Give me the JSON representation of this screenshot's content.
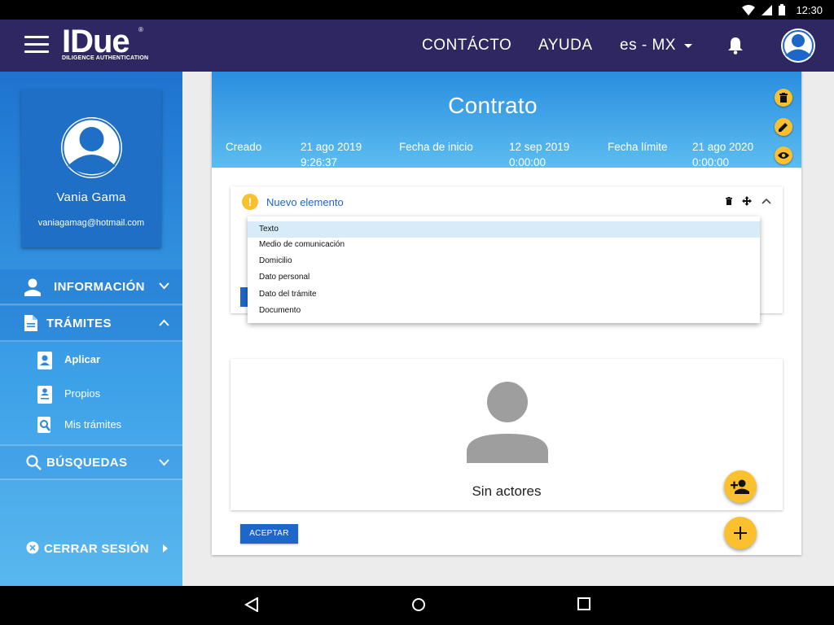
{
  "status_bar": {
    "time": "12:30"
  },
  "app_bar": {
    "logo_text": "IDue",
    "logo_subtitle": "DILIGENCE AUTHENTICATION",
    "logo_reg": "®",
    "nav_contact": "CONTÁCTO",
    "nav_help": "AYUDA",
    "language": "es - MX"
  },
  "sidebar": {
    "user_name": "Vania Gama",
    "user_email": "vaniagamag@hotmail.com",
    "menu": {
      "informacion": "INFORMACIÓN",
      "tramites": "TRÁMITES",
      "busquedas": "BÚSQUEDAS"
    },
    "sub_items": {
      "aplicar": "Aplicar",
      "propios": "Propios",
      "mis_tramites": "Mis trámites"
    },
    "logout": "CERRAR SESIÓN"
  },
  "contract": {
    "title": "Contrato",
    "created_label": "Creado",
    "created_date": "21 ago 2019",
    "created_time": "9:26:37",
    "start_label": "Fecha de inicio",
    "start_date": "12 sep 2019",
    "start_time": "0:00:00",
    "limit_label": "Fecha límite",
    "limit_date": "21 ago 2020",
    "limit_time": "0:00:00"
  },
  "element": {
    "title": "Nuevo elemento",
    "warning_glyph": "!",
    "options": [
      "Texto",
      "Medio de comunicación",
      "Domicilio",
      "Dato personal",
      "Dato del trámite",
      "Documento"
    ],
    "selected": "Texto"
  },
  "actors": {
    "empty_text": "Sin actores"
  },
  "buttons": {
    "accept": "ACEPTAR"
  },
  "colors": {
    "app_bar": "#2e2761",
    "accent": "#fbc02d",
    "primary": "#1e66c8"
  }
}
